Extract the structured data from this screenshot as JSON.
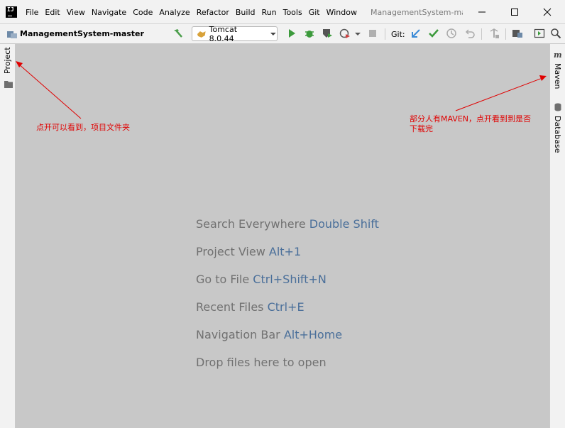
{
  "menubar": {
    "logo": "IJ",
    "items": [
      "File",
      "Edit",
      "View",
      "Navigate",
      "Code",
      "Analyze",
      "Refactor",
      "Build",
      "Run",
      "Tools",
      "Git",
      "Window"
    ],
    "window_title": "ManagementSystem-master"
  },
  "toolbar": {
    "project_name": "ManagementSystem-master",
    "run_config": "Tomcat 8.0.44",
    "git_label": "Git:"
  },
  "left_strip": {
    "project_tab": "Project"
  },
  "right_strip": {
    "maven_tab": "Maven",
    "database_tab": "Database"
  },
  "editor": {
    "hints": [
      {
        "text": "Search Everywhere ",
        "key": "Double Shift"
      },
      {
        "text": "Project View ",
        "key": "Alt+1"
      },
      {
        "text": "Go to File ",
        "key": "Ctrl+Shift+N"
      },
      {
        "text": "Recent Files ",
        "key": "Ctrl+E"
      },
      {
        "text": "Navigation Bar ",
        "key": "Alt+Home"
      },
      {
        "text": "Drop files here to open",
        "key": ""
      }
    ]
  },
  "annotations": {
    "left_note": "点开可以看到，项目文件夹",
    "right_note_line1": "部分人有MAVEN，点开看到到是否",
    "right_note_line2": "下载完"
  },
  "colors": {
    "accent_key": "#4a6f9a",
    "annotation_red": "#e00000",
    "editor_bg": "#c8c8c8"
  }
}
